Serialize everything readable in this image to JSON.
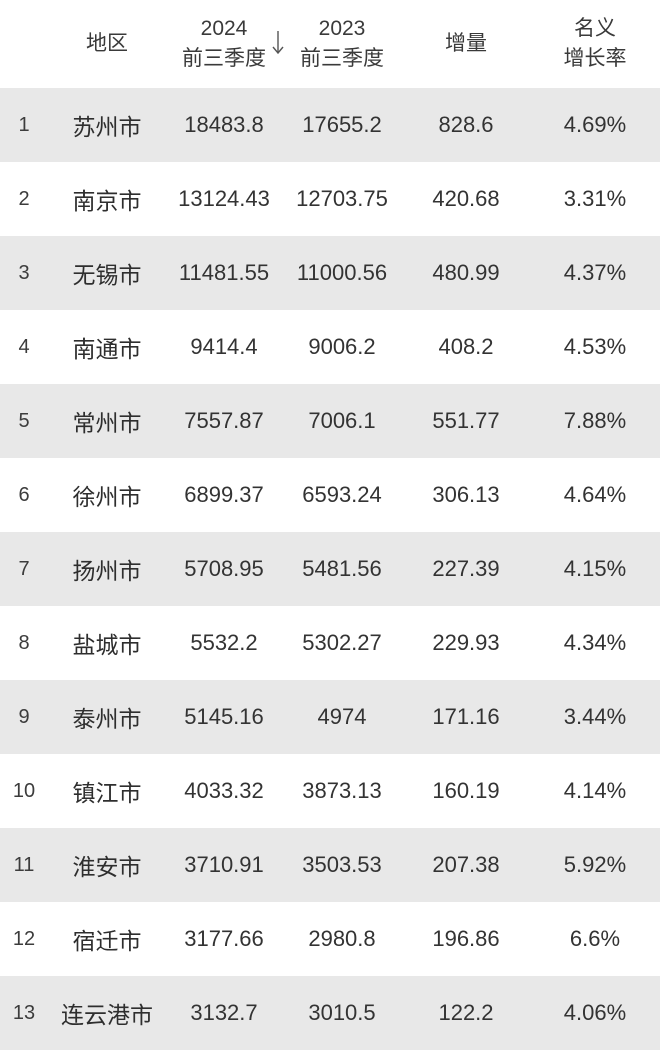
{
  "table": {
    "columns": [
      {
        "key": "rank",
        "label": "",
        "label2": ""
      },
      {
        "key": "region",
        "label": "地区",
        "label2": ""
      },
      {
        "key": "y2024",
        "label": "2024",
        "label2": "前三季度",
        "sort": "desc",
        "sort_icon": "arrow-down-icon"
      },
      {
        "key": "y2023",
        "label": "2023",
        "label2": "前三季度"
      },
      {
        "key": "delta",
        "label": "增量",
        "label2": ""
      },
      {
        "key": "rate",
        "label": "名义",
        "label2": "增长率"
      }
    ],
    "rows": [
      {
        "rank": "1",
        "region": "苏州市",
        "y2024": "18483.8",
        "y2023": "17655.2",
        "delta": "828.6",
        "rate": "4.69%"
      },
      {
        "rank": "2",
        "region": "南京市",
        "y2024": "13124.43",
        "y2023": "12703.75",
        "delta": "420.68",
        "rate": "3.31%"
      },
      {
        "rank": "3",
        "region": "无锡市",
        "y2024": "11481.55",
        "y2023": "11000.56",
        "delta": "480.99",
        "rate": "4.37%"
      },
      {
        "rank": "4",
        "region": "南通市",
        "y2024": "9414.4",
        "y2023": "9006.2",
        "delta": "408.2",
        "rate": "4.53%"
      },
      {
        "rank": "5",
        "region": "常州市",
        "y2024": "7557.87",
        "y2023": "7006.1",
        "delta": "551.77",
        "rate": "7.88%"
      },
      {
        "rank": "6",
        "region": "徐州市",
        "y2024": "6899.37",
        "y2023": "6593.24",
        "delta": "306.13",
        "rate": "4.64%"
      },
      {
        "rank": "7",
        "region": "扬州市",
        "y2024": "5708.95",
        "y2023": "5481.56",
        "delta": "227.39",
        "rate": "4.15%"
      },
      {
        "rank": "8",
        "region": "盐城市",
        "y2024": "5532.2",
        "y2023": "5302.27",
        "delta": "229.93",
        "rate": "4.34%"
      },
      {
        "rank": "9",
        "region": "泰州市",
        "y2024": "5145.16",
        "y2023": "4974",
        "delta": "171.16",
        "rate": "3.44%"
      },
      {
        "rank": "10",
        "region": "镇江市",
        "y2024": "4033.32",
        "y2023": "3873.13",
        "delta": "160.19",
        "rate": "4.14%"
      },
      {
        "rank": "11",
        "region": "淮安市",
        "y2024": "3710.91",
        "y2023": "3503.53",
        "delta": "207.38",
        "rate": "5.92%"
      },
      {
        "rank": "12",
        "region": "宿迁市",
        "y2024": "3177.66",
        "y2023": "2980.8",
        "delta": "196.86",
        "rate": "6.6%"
      },
      {
        "rank": "13",
        "region": "连云港市",
        "y2024": "3132.7",
        "y2023": "3010.5",
        "delta": "122.2",
        "rate": "4.06%"
      }
    ]
  },
  "colors": {
    "row_odd_bg": "#e8e8e8",
    "row_even_bg": "#ffffff",
    "text": "#333333",
    "header_text": "#3a3a3a"
  }
}
